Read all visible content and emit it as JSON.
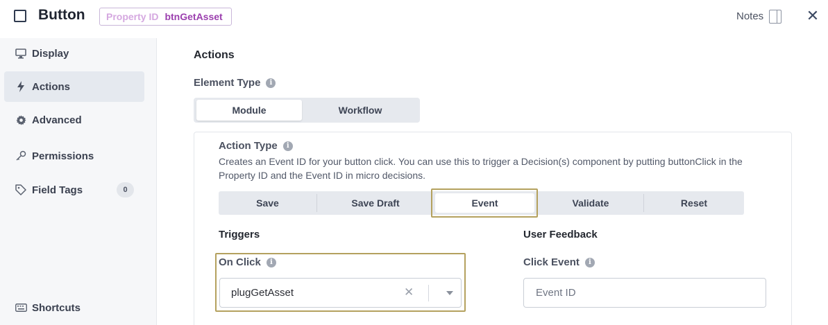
{
  "header": {
    "title": "Button",
    "property_label": "Property ID",
    "property_value": "btnGetAsset",
    "notes_label": "Notes",
    "close_symbol": "✕"
  },
  "sidebar": {
    "items": [
      {
        "label": "Display",
        "icon": "monitor-icon",
        "active": false
      },
      {
        "label": "Actions",
        "icon": "bolt-icon",
        "active": true
      },
      {
        "label": "Advanced",
        "icon": "gear-icon",
        "active": false
      },
      {
        "label": "Permissions",
        "icon": "key-icon",
        "active": false
      },
      {
        "label": "Field Tags",
        "icon": "tag-icon",
        "active": false,
        "count": "0"
      },
      {
        "label": "Shortcuts",
        "icon": "keyboard-icon",
        "active": false
      }
    ]
  },
  "main": {
    "title": "Actions",
    "element_type": {
      "label": "Element Type",
      "options": [
        "Module",
        "Workflow"
      ],
      "selected": "Module"
    },
    "action_type": {
      "label": "Action Type",
      "description": "Creates an Event ID for your button click. You can use this to trigger a Decision(s) component by putting buttonClick in the Property ID and the Event ID in micro decisions.",
      "tabs": [
        "Save",
        "Save Draft",
        "Event",
        "Validate",
        "Reset"
      ],
      "selected": "Event"
    },
    "triggers": {
      "title": "Triggers",
      "on_click_label": "On Click",
      "on_click_value": "plugGetAsset",
      "clear_symbol": "✕"
    },
    "user_feedback": {
      "title": "User Feedback",
      "click_event_label": "Click Event",
      "click_event_placeholder": "Event ID"
    }
  },
  "colors": {
    "highlight_border": "#b4a15e",
    "property_accent": "#9b3fae",
    "sidebar_active_bg": "#e5e9ef"
  }
}
